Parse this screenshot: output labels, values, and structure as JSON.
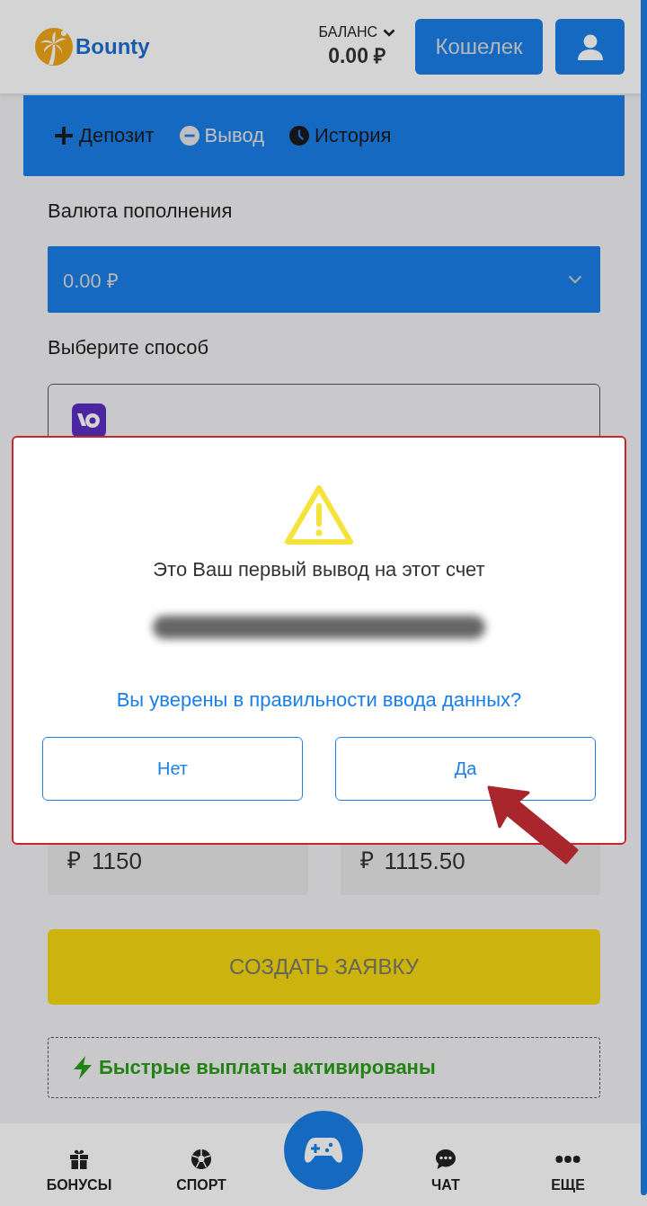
{
  "header": {
    "logo_text": "Bounty",
    "balance_label": "БАЛАНС",
    "balance": "0.00 ₽",
    "wallet_button": "Кошелек"
  },
  "tabs": [
    {
      "label": "Депозит",
      "selected": false
    },
    {
      "label": "Вывод",
      "selected": true
    },
    {
      "label": "История",
      "selected": false
    }
  ],
  "currency_label": "Валюта пополнения",
  "currency_select": {
    "value": "0.00 ₽"
  },
  "method_label": "Выберите способ",
  "amounts": [
    {
      "currency": "₽",
      "value": "1150"
    },
    {
      "currency": "₽",
      "value": "1115.50"
    }
  ],
  "create_button": {
    "label": "СОЗДАТЬ ЗАЯВКУ",
    "disabled": true
  },
  "fast_payouts": "Быстрые выплаты активированы",
  "bottom_nav": [
    {
      "label": "БОНУСЫ"
    },
    {
      "label": "СПОРТ"
    },
    {
      "label": "ЧАТ"
    },
    {
      "label": "ЕЩЕ"
    }
  ],
  "dialog": {
    "message": "Это Ваш первый вывод на этот счет",
    "question": "Вы уверены в правильности ввода данных?",
    "buttons": [
      "Нет",
      "Да"
    ]
  }
}
